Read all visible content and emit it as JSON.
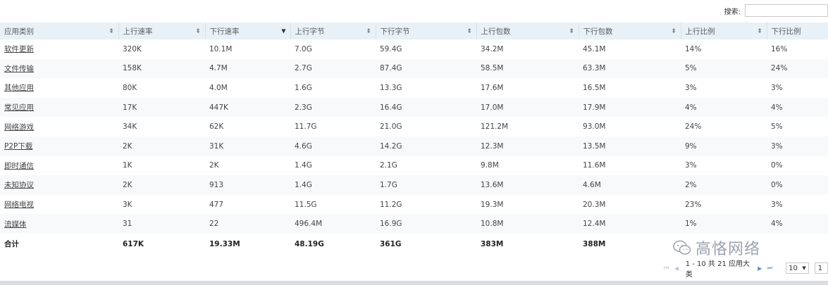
{
  "search": {
    "label": "搜索:",
    "value": ""
  },
  "columns": [
    {
      "label": "应用类别",
      "sort": "⇕"
    },
    {
      "label": "上行速率",
      "sort": "⇕"
    },
    {
      "label": "下行速率",
      "sort": "▼"
    },
    {
      "label": "上行字节",
      "sort": "⇕"
    },
    {
      "label": "下行字节",
      "sort": "⇕"
    },
    {
      "label": "上行包数",
      "sort": "⇕"
    },
    {
      "label": "下行包数",
      "sort": "⇕"
    },
    {
      "label": "上行比例",
      "sort": "⇕"
    },
    {
      "label": "下行比例",
      "sort": ""
    }
  ],
  "rows": [
    [
      "软件更新",
      "320K",
      "10.1M",
      "7.0G",
      "59.4G",
      "34.2M",
      "45.1M",
      "14%",
      "16%"
    ],
    [
      "文件传输",
      "158K",
      "4.7M",
      "2.7G",
      "87.4G",
      "58.5M",
      "63.3M",
      "5%",
      "24%"
    ],
    [
      "其他应用",
      "80K",
      "4.0M",
      "1.6G",
      "13.3G",
      "17.6M",
      "16.5M",
      "3%",
      "3%"
    ],
    [
      "常见应用",
      "17K",
      "447K",
      "2.3G",
      "16.4G",
      "17.0M",
      "17.9M",
      "4%",
      "4%"
    ],
    [
      "网络游戏",
      "34K",
      "62K",
      "11.7G",
      "21.0G",
      "121.2M",
      "93.0M",
      "24%",
      "5%"
    ],
    [
      "P2P下载",
      "2K",
      "31K",
      "4.6G",
      "14.2G",
      "12.3M",
      "13.5M",
      "9%",
      "3%"
    ],
    [
      "即时通信",
      "1K",
      "2K",
      "1.4G",
      "2.1G",
      "9.8M",
      "11.6M",
      "3%",
      "0%"
    ],
    [
      "未知协议",
      "2K",
      "913",
      "1.4G",
      "1.7G",
      "13.6M",
      "4.6M",
      "2%",
      "0%"
    ],
    [
      "网络电视",
      "3K",
      "477",
      "11.5G",
      "11.2G",
      "19.3M",
      "20.3M",
      "23%",
      "3%"
    ],
    [
      "流媒体",
      "31",
      "22",
      "496.4M",
      "16.9G",
      "10.8M",
      "12.4M",
      "1%",
      "4%"
    ]
  ],
  "total": [
    "合计",
    "617K",
    "19.33M",
    "48.19G",
    "361G",
    "383M",
    "388M",
    "",
    ""
  ],
  "watermark": "高恪网络",
  "pager": {
    "info": "1 - 10 共 21 应用大类",
    "page_size": "10",
    "page_number": "1"
  }
}
